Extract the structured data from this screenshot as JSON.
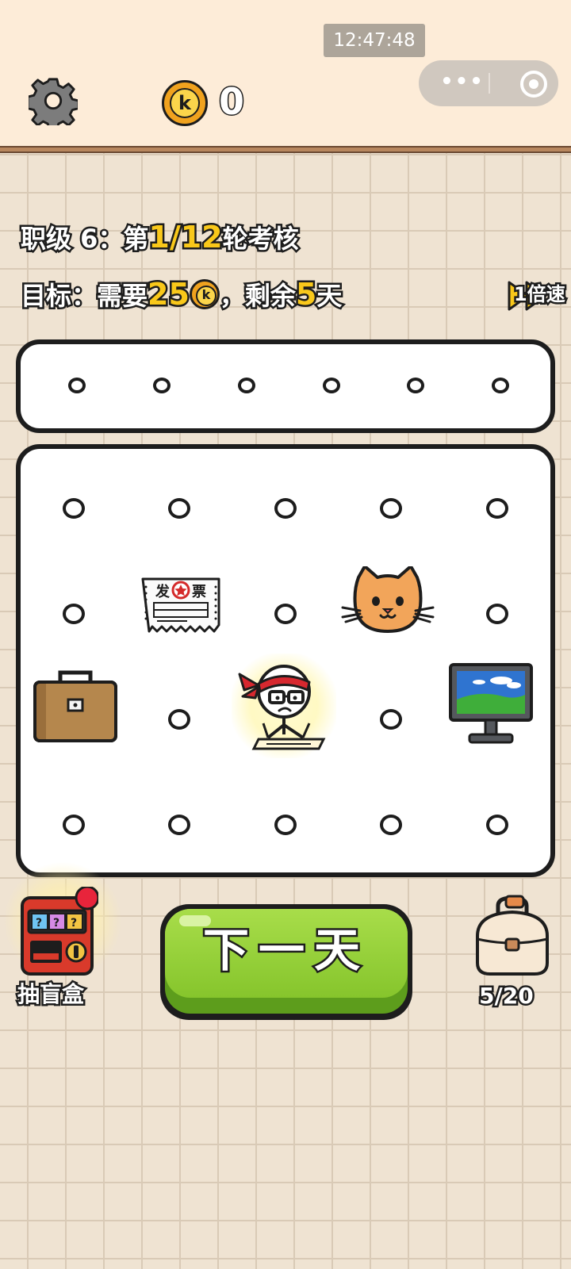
{
  "status": {
    "clock": "12:47:48"
  },
  "capsule": {
    "more_label": "•••"
  },
  "header": {
    "coin_letter": "k",
    "coin_count": "0"
  },
  "level": {
    "prefix": "职级 6：第",
    "round": "1/12",
    "suffix": "轮考核"
  },
  "goal": {
    "prefix": "目标：需要",
    "amount": "25",
    "coin_letter": "k",
    "middle": "，剩余",
    "days": "5",
    "suffix": "天"
  },
  "speed": {
    "label": "1倍速"
  },
  "invoice": {
    "title_left": "发",
    "title_right": "票"
  },
  "actions": {
    "blind_box_label": "抽盲盒",
    "next_day_label": "下一天",
    "bag_count": "5/20"
  },
  "colors": {
    "topbar": "#fdecd8",
    "grid_bg": "#efe3d2",
    "highlight_yellow": "#f9c81a",
    "button_green": "#8fcb32",
    "notification_red": "#e8243b"
  },
  "icons": [
    "gear-icon",
    "coin-icon",
    "fast-forward-icon",
    "invoice-icon",
    "cat-icon",
    "briefcase-icon",
    "worker-character",
    "monitor-icon",
    "slot-machine-icon",
    "backpack-icon"
  ]
}
